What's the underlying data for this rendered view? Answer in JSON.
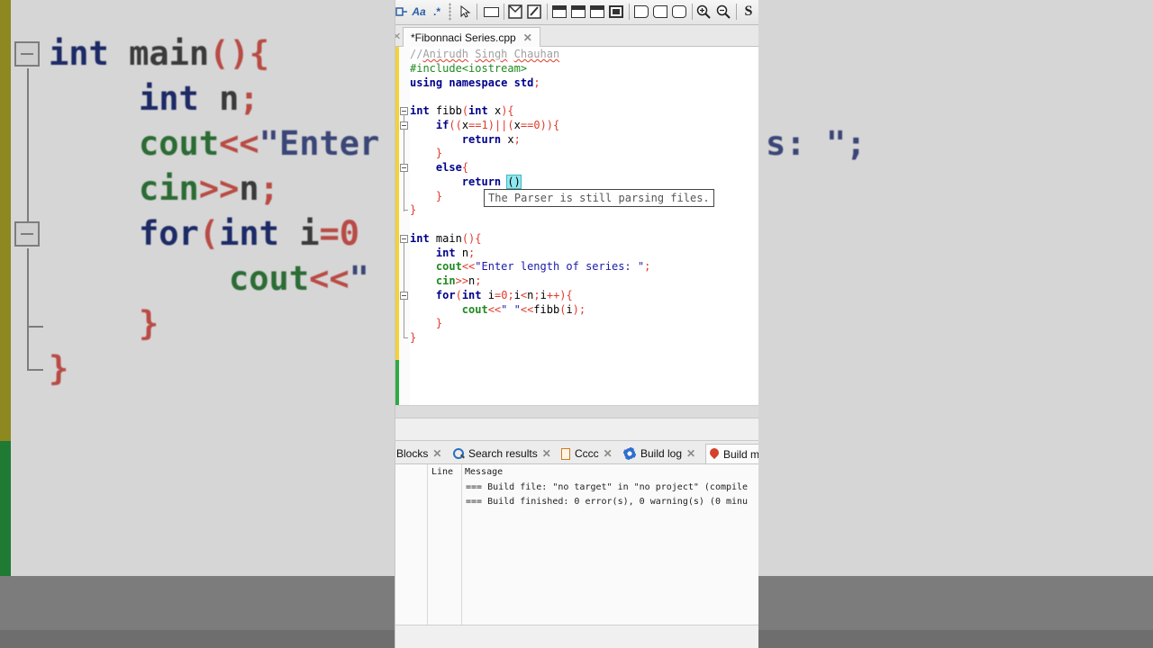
{
  "background": {
    "lines": [
      {
        "parts": [
          {
            "t": "int ",
            "c": "bg-kw"
          },
          {
            "t": "main",
            "c": "bg-id"
          },
          {
            "t": "(){",
            "c": "bg-op"
          }
        ]
      },
      {
        "parts": [
          {
            "t": "int ",
            "c": "bg-kw"
          },
          {
            "t": "n",
            "c": "bg-id"
          },
          {
            "t": ";",
            "c": "bg-op"
          }
        ]
      },
      {
        "parts": [
          {
            "t": "cout",
            "c": "bg-fn"
          },
          {
            "t": "<<",
            "c": "bg-op"
          },
          {
            "t": "\"Enter",
            "c": "bg-str"
          }
        ]
      },
      {
        "parts": [
          {
            "t": "cin",
            "c": "bg-fn"
          },
          {
            "t": ">>",
            "c": "bg-op"
          },
          {
            "t": "n",
            "c": "bg-id"
          },
          {
            "t": ";",
            "c": "bg-op"
          }
        ]
      },
      {
        "parts": [
          {
            "t": "for",
            "c": "bg-kw"
          },
          {
            "t": "(",
            "c": "bg-op"
          },
          {
            "t": "int ",
            "c": "bg-kw"
          },
          {
            "t": "i",
            "c": "bg-id"
          },
          {
            "t": "=0",
            "c": "bg-op"
          }
        ]
      },
      {
        "parts": [
          {
            "t": "cout",
            "c": "bg-fn"
          },
          {
            "t": "<<",
            "c": "bg-op"
          },
          {
            "t": "\"",
            "c": "bg-str"
          }
        ]
      },
      {
        "parts": [
          {
            "t": "}",
            "c": "bg-op"
          }
        ]
      },
      {
        "parts": [
          {
            "t": "}",
            "c": "bg-op"
          }
        ]
      },
      {
        "parts": [
          {
            "t": "s: ",
            "c": "bg-str"
          },
          {
            "t": "\";",
            "c": "bg-str"
          }
        ]
      }
    ]
  },
  "toolbar": {
    "match_case_label": "Aa",
    "regex_label": ".*",
    "s_label": "S"
  },
  "tab": {
    "title": "*Fibonnaci Series.cpp",
    "close": "✕"
  },
  "editor": {
    "lines": [
      {
        "parts": [
          {
            "t": "//",
            "c": "cm"
          },
          {
            "t": "Anirudh",
            "c": "cm cm-u"
          },
          {
            "t": " ",
            "c": "cm"
          },
          {
            "t": "Singh",
            "c": "cm cm-u"
          },
          {
            "t": " ",
            "c": "cm"
          },
          {
            "t": "Chauhan",
            "c": "cm cm-u"
          }
        ]
      },
      {
        "parts": [
          {
            "t": "#include<iostream>",
            "c": "pp"
          }
        ]
      },
      {
        "parts": [
          {
            "t": "using",
            "c": "kw"
          },
          {
            "t": " "
          },
          {
            "t": "namespace",
            "c": "kw"
          },
          {
            "t": " "
          },
          {
            "t": "std",
            "c": "kw"
          },
          {
            "t": ";",
            "c": "op"
          }
        ]
      },
      {
        "parts": []
      },
      {
        "parts": [
          {
            "t": "int",
            "c": "kw"
          },
          {
            "t": " fibb"
          },
          {
            "t": "(",
            "c": "op"
          },
          {
            "t": "int",
            "c": "kw"
          },
          {
            "t": " x"
          },
          {
            "t": "){",
            "c": "op"
          }
        ]
      },
      {
        "parts": [
          {
            "t": "    "
          },
          {
            "t": "if",
            "c": "kw"
          },
          {
            "t": "((",
            "c": "op"
          },
          {
            "t": "x"
          },
          {
            "t": "==",
            "c": "op"
          },
          {
            "t": "1",
            "c": "num"
          },
          {
            "t": ")||(",
            "c": "op"
          },
          {
            "t": "x"
          },
          {
            "t": "==",
            "c": "op"
          },
          {
            "t": "0",
            "c": "num"
          },
          {
            "t": ")){",
            "c": "op"
          }
        ]
      },
      {
        "parts": [
          {
            "t": "        "
          },
          {
            "t": "return",
            "c": "kw"
          },
          {
            "t": " x"
          },
          {
            "t": ";",
            "c": "op"
          }
        ]
      },
      {
        "parts": [
          {
            "t": "    "
          },
          {
            "t": "}",
            "c": "op"
          }
        ]
      },
      {
        "parts": [
          {
            "t": "    "
          },
          {
            "t": "else",
            "c": "kw"
          },
          {
            "t": "{",
            "c": "op"
          }
        ]
      },
      {
        "parts": [
          {
            "t": "        "
          },
          {
            "t": "return",
            "c": "kw"
          },
          {
            "t": " "
          },
          {
            "t": "()",
            "c": "caret"
          }
        ]
      },
      {
        "parts": [
          {
            "t": "    "
          },
          {
            "t": "}",
            "c": "op"
          }
        ]
      },
      {
        "parts": [
          {
            "t": "}",
            "c": "op"
          }
        ]
      },
      {
        "parts": []
      },
      {
        "parts": [
          {
            "t": "int",
            "c": "kw"
          },
          {
            "t": " main"
          },
          {
            "t": "(){",
            "c": "op"
          }
        ]
      },
      {
        "parts": [
          {
            "t": "    "
          },
          {
            "t": "int",
            "c": "kw"
          },
          {
            "t": " n"
          },
          {
            "t": ";",
            "c": "op"
          }
        ]
      },
      {
        "parts": [
          {
            "t": "    "
          },
          {
            "t": "cout",
            "c": "fn"
          },
          {
            "t": "<<",
            "c": "op"
          },
          {
            "t": "\"Enter length of series: \"",
            "c": "str"
          },
          {
            "t": ";",
            "c": "op"
          }
        ]
      },
      {
        "parts": [
          {
            "t": "    "
          },
          {
            "t": "cin",
            "c": "fn"
          },
          {
            "t": ">>",
            "c": "op"
          },
          {
            "t": "n"
          },
          {
            "t": ";",
            "c": "op"
          }
        ]
      },
      {
        "parts": [
          {
            "t": "    "
          },
          {
            "t": "for",
            "c": "kw"
          },
          {
            "t": "(",
            "c": "op"
          },
          {
            "t": "int",
            "c": "kw"
          },
          {
            "t": " i"
          },
          {
            "t": "=",
            "c": "op"
          },
          {
            "t": "0",
            "c": "num"
          },
          {
            "t": ";",
            "c": "op"
          },
          {
            "t": "i"
          },
          {
            "t": "<",
            "c": "op"
          },
          {
            "t": "n"
          },
          {
            "t": ";",
            "c": "op"
          },
          {
            "t": "i"
          },
          {
            "t": "++){",
            "c": "op"
          }
        ]
      },
      {
        "parts": [
          {
            "t": "        "
          },
          {
            "t": "cout",
            "c": "fn"
          },
          {
            "t": "<<",
            "c": "op"
          },
          {
            "t": "\" \"",
            "c": "str"
          },
          {
            "t": "<<",
            "c": "op"
          },
          {
            "t": "fibb"
          },
          {
            "t": "(",
            "c": "op"
          },
          {
            "t": "i"
          },
          {
            "t": ");",
            "c": "op"
          }
        ]
      },
      {
        "parts": [
          {
            "t": "    "
          },
          {
            "t": "}",
            "c": "op"
          }
        ]
      },
      {
        "parts": [
          {
            "t": "}",
            "c": "op"
          }
        ]
      }
    ],
    "tooltip": "The Parser is still parsing files."
  },
  "log_tabs": [
    {
      "label": "Blocks",
      "icon": "none"
    },
    {
      "label": "Search results",
      "icon": "search-icon"
    },
    {
      "label": "Cccc",
      "icon": "document-icon"
    },
    {
      "label": "Build log",
      "icon": "gear-icon"
    },
    {
      "label": "Build m",
      "icon": "pin-icon"
    }
  ],
  "build_messages": {
    "col_line": "Line",
    "col_message": "Message",
    "rows": [
      "=== Build file: \"no target\" in \"no project\" (compile",
      "=== Build finished: 0 error(s), 0 warning(s) (0 minu"
    ]
  }
}
